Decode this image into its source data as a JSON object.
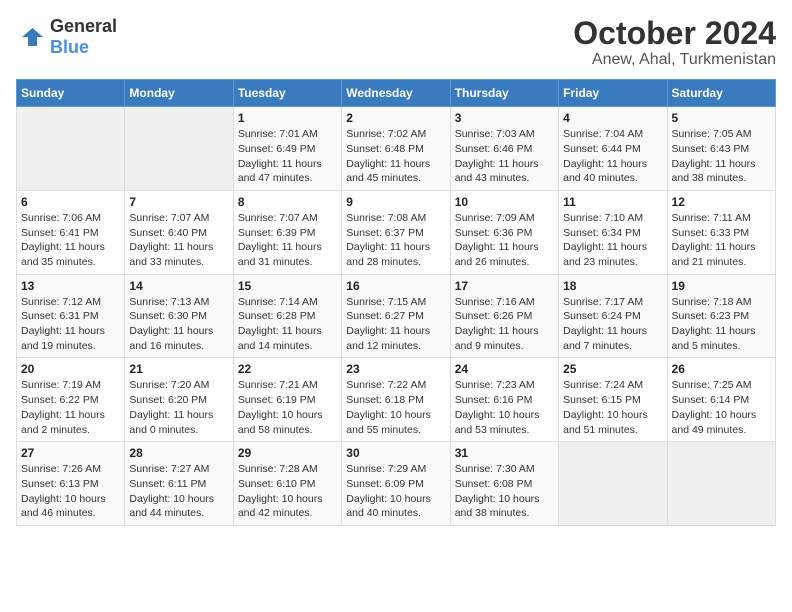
{
  "logo": {
    "general": "General",
    "blue": "Blue"
  },
  "title": "October 2024",
  "subtitle": "Anew, Ahal, Turkmenistan",
  "days_of_week": [
    "Sunday",
    "Monday",
    "Tuesday",
    "Wednesday",
    "Thursday",
    "Friday",
    "Saturday"
  ],
  "weeks": [
    [
      {
        "day": "",
        "empty": true
      },
      {
        "day": "",
        "empty": true
      },
      {
        "day": "1",
        "sunrise": "Sunrise: 7:01 AM",
        "sunset": "Sunset: 6:49 PM",
        "daylight": "Daylight: 11 hours and 47 minutes."
      },
      {
        "day": "2",
        "sunrise": "Sunrise: 7:02 AM",
        "sunset": "Sunset: 6:48 PM",
        "daylight": "Daylight: 11 hours and 45 minutes."
      },
      {
        "day": "3",
        "sunrise": "Sunrise: 7:03 AM",
        "sunset": "Sunset: 6:46 PM",
        "daylight": "Daylight: 11 hours and 43 minutes."
      },
      {
        "day": "4",
        "sunrise": "Sunrise: 7:04 AM",
        "sunset": "Sunset: 6:44 PM",
        "daylight": "Daylight: 11 hours and 40 minutes."
      },
      {
        "day": "5",
        "sunrise": "Sunrise: 7:05 AM",
        "sunset": "Sunset: 6:43 PM",
        "daylight": "Daylight: 11 hours and 38 minutes."
      }
    ],
    [
      {
        "day": "6",
        "sunrise": "Sunrise: 7:06 AM",
        "sunset": "Sunset: 6:41 PM",
        "daylight": "Daylight: 11 hours and 35 minutes."
      },
      {
        "day": "7",
        "sunrise": "Sunrise: 7:07 AM",
        "sunset": "Sunset: 6:40 PM",
        "daylight": "Daylight: 11 hours and 33 minutes."
      },
      {
        "day": "8",
        "sunrise": "Sunrise: 7:07 AM",
        "sunset": "Sunset: 6:39 PM",
        "daylight": "Daylight: 11 hours and 31 minutes."
      },
      {
        "day": "9",
        "sunrise": "Sunrise: 7:08 AM",
        "sunset": "Sunset: 6:37 PM",
        "daylight": "Daylight: 11 hours and 28 minutes."
      },
      {
        "day": "10",
        "sunrise": "Sunrise: 7:09 AM",
        "sunset": "Sunset: 6:36 PM",
        "daylight": "Daylight: 11 hours and 26 minutes."
      },
      {
        "day": "11",
        "sunrise": "Sunrise: 7:10 AM",
        "sunset": "Sunset: 6:34 PM",
        "daylight": "Daylight: 11 hours and 23 minutes."
      },
      {
        "day": "12",
        "sunrise": "Sunrise: 7:11 AM",
        "sunset": "Sunset: 6:33 PM",
        "daylight": "Daylight: 11 hours and 21 minutes."
      }
    ],
    [
      {
        "day": "13",
        "sunrise": "Sunrise: 7:12 AM",
        "sunset": "Sunset: 6:31 PM",
        "daylight": "Daylight: 11 hours and 19 minutes."
      },
      {
        "day": "14",
        "sunrise": "Sunrise: 7:13 AM",
        "sunset": "Sunset: 6:30 PM",
        "daylight": "Daylight: 11 hours and 16 minutes."
      },
      {
        "day": "15",
        "sunrise": "Sunrise: 7:14 AM",
        "sunset": "Sunset: 6:28 PM",
        "daylight": "Daylight: 11 hours and 14 minutes."
      },
      {
        "day": "16",
        "sunrise": "Sunrise: 7:15 AM",
        "sunset": "Sunset: 6:27 PM",
        "daylight": "Daylight: 11 hours and 12 minutes."
      },
      {
        "day": "17",
        "sunrise": "Sunrise: 7:16 AM",
        "sunset": "Sunset: 6:26 PM",
        "daylight": "Daylight: 11 hours and 9 minutes."
      },
      {
        "day": "18",
        "sunrise": "Sunrise: 7:17 AM",
        "sunset": "Sunset: 6:24 PM",
        "daylight": "Daylight: 11 hours and 7 minutes."
      },
      {
        "day": "19",
        "sunrise": "Sunrise: 7:18 AM",
        "sunset": "Sunset: 6:23 PM",
        "daylight": "Daylight: 11 hours and 5 minutes."
      }
    ],
    [
      {
        "day": "20",
        "sunrise": "Sunrise: 7:19 AM",
        "sunset": "Sunset: 6:22 PM",
        "daylight": "Daylight: 11 hours and 2 minutes."
      },
      {
        "day": "21",
        "sunrise": "Sunrise: 7:20 AM",
        "sunset": "Sunset: 6:20 PM",
        "daylight": "Daylight: 11 hours and 0 minutes."
      },
      {
        "day": "22",
        "sunrise": "Sunrise: 7:21 AM",
        "sunset": "Sunset: 6:19 PM",
        "daylight": "Daylight: 10 hours and 58 minutes."
      },
      {
        "day": "23",
        "sunrise": "Sunrise: 7:22 AM",
        "sunset": "Sunset: 6:18 PM",
        "daylight": "Daylight: 10 hours and 55 minutes."
      },
      {
        "day": "24",
        "sunrise": "Sunrise: 7:23 AM",
        "sunset": "Sunset: 6:16 PM",
        "daylight": "Daylight: 10 hours and 53 minutes."
      },
      {
        "day": "25",
        "sunrise": "Sunrise: 7:24 AM",
        "sunset": "Sunset: 6:15 PM",
        "daylight": "Daylight: 10 hours and 51 minutes."
      },
      {
        "day": "26",
        "sunrise": "Sunrise: 7:25 AM",
        "sunset": "Sunset: 6:14 PM",
        "daylight": "Daylight: 10 hours and 49 minutes."
      }
    ],
    [
      {
        "day": "27",
        "sunrise": "Sunrise: 7:26 AM",
        "sunset": "Sunset: 6:13 PM",
        "daylight": "Daylight: 10 hours and 46 minutes."
      },
      {
        "day": "28",
        "sunrise": "Sunrise: 7:27 AM",
        "sunset": "Sunset: 6:11 PM",
        "daylight": "Daylight: 10 hours and 44 minutes."
      },
      {
        "day": "29",
        "sunrise": "Sunrise: 7:28 AM",
        "sunset": "Sunset: 6:10 PM",
        "daylight": "Daylight: 10 hours and 42 minutes."
      },
      {
        "day": "30",
        "sunrise": "Sunrise: 7:29 AM",
        "sunset": "Sunset: 6:09 PM",
        "daylight": "Daylight: 10 hours and 40 minutes."
      },
      {
        "day": "31",
        "sunrise": "Sunrise: 7:30 AM",
        "sunset": "Sunset: 6:08 PM",
        "daylight": "Daylight: 10 hours and 38 minutes."
      },
      {
        "day": "",
        "empty": true
      },
      {
        "day": "",
        "empty": true
      }
    ]
  ]
}
